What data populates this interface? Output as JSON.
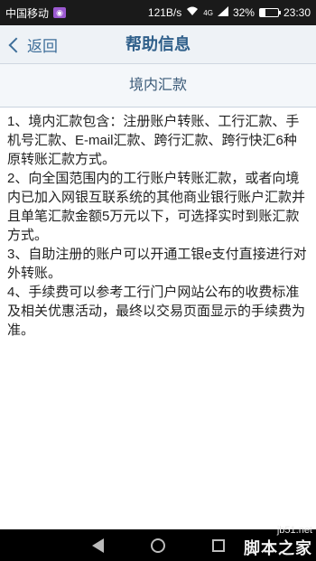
{
  "status_bar": {
    "carrier": "中国移动",
    "speed": "121B/s",
    "network": "4G",
    "battery": "32%",
    "battery_level": 0.32,
    "time": "23:30"
  },
  "header": {
    "back_label": "返回",
    "title": "帮助信息"
  },
  "section": {
    "title": "境内汇款"
  },
  "content": {
    "paragraphs": [
      "1、境内汇款包含：注册账户转账、工行汇款、手机号汇款、E-mail汇款、跨行汇款、跨行快汇6种原转账汇款方式。",
      "2、向全国范围内的工行账户转账汇款，或者向境内已加入网银互联系统的其他商业银行账户汇款并且单笔汇款金额5万元以下，可选择实时到账汇款方式。",
      "3、自助注册的账户可以开通工银e支付直接进行对外转账。",
      "4、手续费可以参考工行门户网站公布的收费标准及相关优惠活动，最终以交易页面显示的手续费为准。"
    ]
  },
  "watermark": {
    "url": "jb51.net",
    "name": "脚本之家"
  }
}
